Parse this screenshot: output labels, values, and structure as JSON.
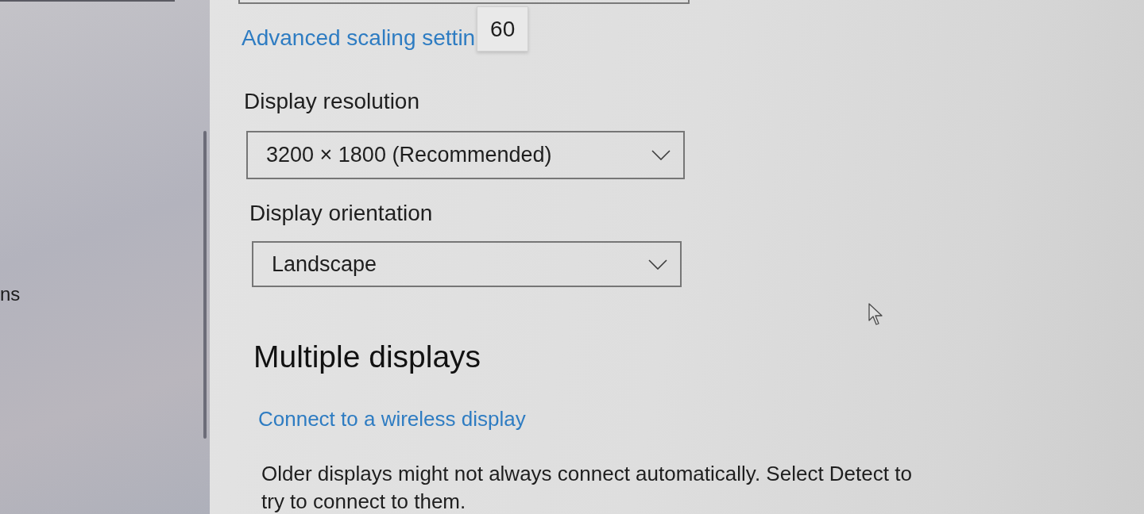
{
  "sidebar": {
    "items": [
      {
        "label": "ns"
      }
    ]
  },
  "scaling": {
    "link": "Advanced scaling settin",
    "tooltip": "60"
  },
  "dropdowns": [
    {
      "label": "Display resolution",
      "value": "3200 × 1800 (Recommended)"
    },
    {
      "label": "Display orientation",
      "value": "Landscape"
    }
  ],
  "multiple_displays": {
    "heading": "Multiple displays",
    "link": "Connect to a wireless display",
    "description": "Older displays might not always connect automatically. Select Detect to try to connect to them."
  }
}
